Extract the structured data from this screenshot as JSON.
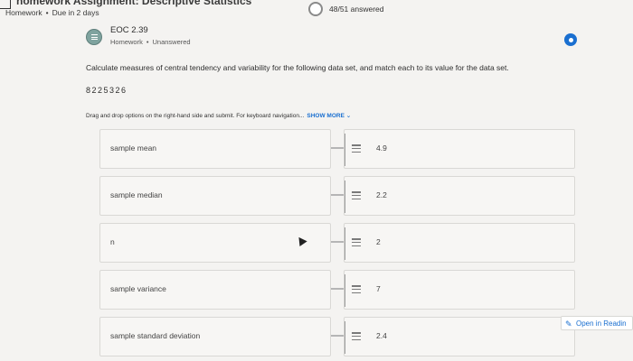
{
  "header": {
    "title": "nomework Assignment: Descriptive Statistics",
    "type": "Homework",
    "due": "Due in 2 days",
    "progress_text": "48/51 answered",
    "progress_fraction": 0.94
  },
  "question": {
    "title": "EOC 2.39",
    "type": "Homework",
    "status": "Unanswered",
    "prompt": "Calculate measures of central tendency and variability for the following data set, and match each to its value for the data set.",
    "dataset": "8225326",
    "instructions": "Drag and drop options on the right-hand side and submit. For keyboard navigation...",
    "show_more": "SHOW MORE"
  },
  "matching": [
    {
      "term": "sample mean",
      "value": "4.9"
    },
    {
      "term": "sample median",
      "value": "2.2"
    },
    {
      "term": "n",
      "value": "2"
    },
    {
      "term": "sample variance",
      "value": "7"
    },
    {
      "term": "sample standard deviation",
      "value": "2.4"
    }
  ],
  "reading_mode": {
    "label": "Open in Readin"
  },
  "colors": {
    "accent": "#1a6fd0",
    "icon_teal": "#7fa39f"
  }
}
